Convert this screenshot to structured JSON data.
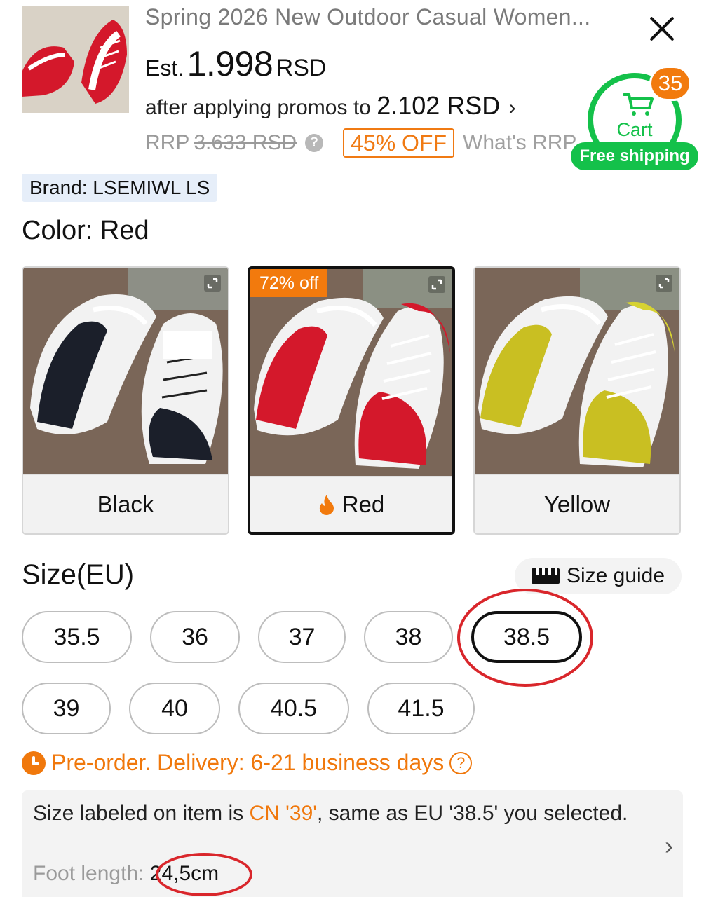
{
  "product": {
    "title": "Spring 2026 New Outdoor Casual Women...",
    "est_label": "Est.",
    "price": "1.998",
    "currency": "RSD",
    "promo_prefix": "after applying promos to",
    "promo_price": "2.102 RSD",
    "promo_chevron": "›",
    "rrp_label": "RRP",
    "rrp_price": "3.633 RSD",
    "rrp_help": "?",
    "discount": "45% OFF",
    "whats_rrp": "What's RRP"
  },
  "cart": {
    "label": "Cart",
    "count": "35",
    "free_shipping": "Free shipping",
    "accent": "#14c14a",
    "badge_color": "#f27a0d"
  },
  "brand": {
    "text": "Brand: LSEMIWL LS"
  },
  "color": {
    "label": "Color: Red",
    "options": [
      {
        "name": "Black",
        "accent": "#1b1f2a"
      },
      {
        "name": "Red",
        "accent": "#d4182b",
        "tag": "72% off",
        "selected": true
      },
      {
        "name": "Yellow",
        "accent": "#c9bf22"
      }
    ]
  },
  "size": {
    "label": "Size(EU)",
    "guide_label": "Size guide",
    "options": [
      "35.5",
      "36",
      "37",
      "38",
      "38.5",
      "39",
      "40",
      "40.5",
      "41.5"
    ],
    "selected": "38.5"
  },
  "delivery": {
    "text": "Pre-order. Delivery: 6-21 business days",
    "help": "?"
  },
  "size_info": {
    "part1": "Size labeled on item is ",
    "cn_size": "CN '39'",
    "part2": ", same as EU '38.5' you selected.",
    "foot_label": "Foot length: ",
    "foot_value": "24,5cm",
    "chevron": "›"
  },
  "icons": [
    "close-icon",
    "cart-icon",
    "expand-icon",
    "flame-icon",
    "ruler-icon",
    "clock-icon",
    "help-icon",
    "chevron-right-icon"
  ],
  "colors": {
    "orange": "#f0780c",
    "green": "#14c14a",
    "annotation_red": "#d9262b"
  }
}
